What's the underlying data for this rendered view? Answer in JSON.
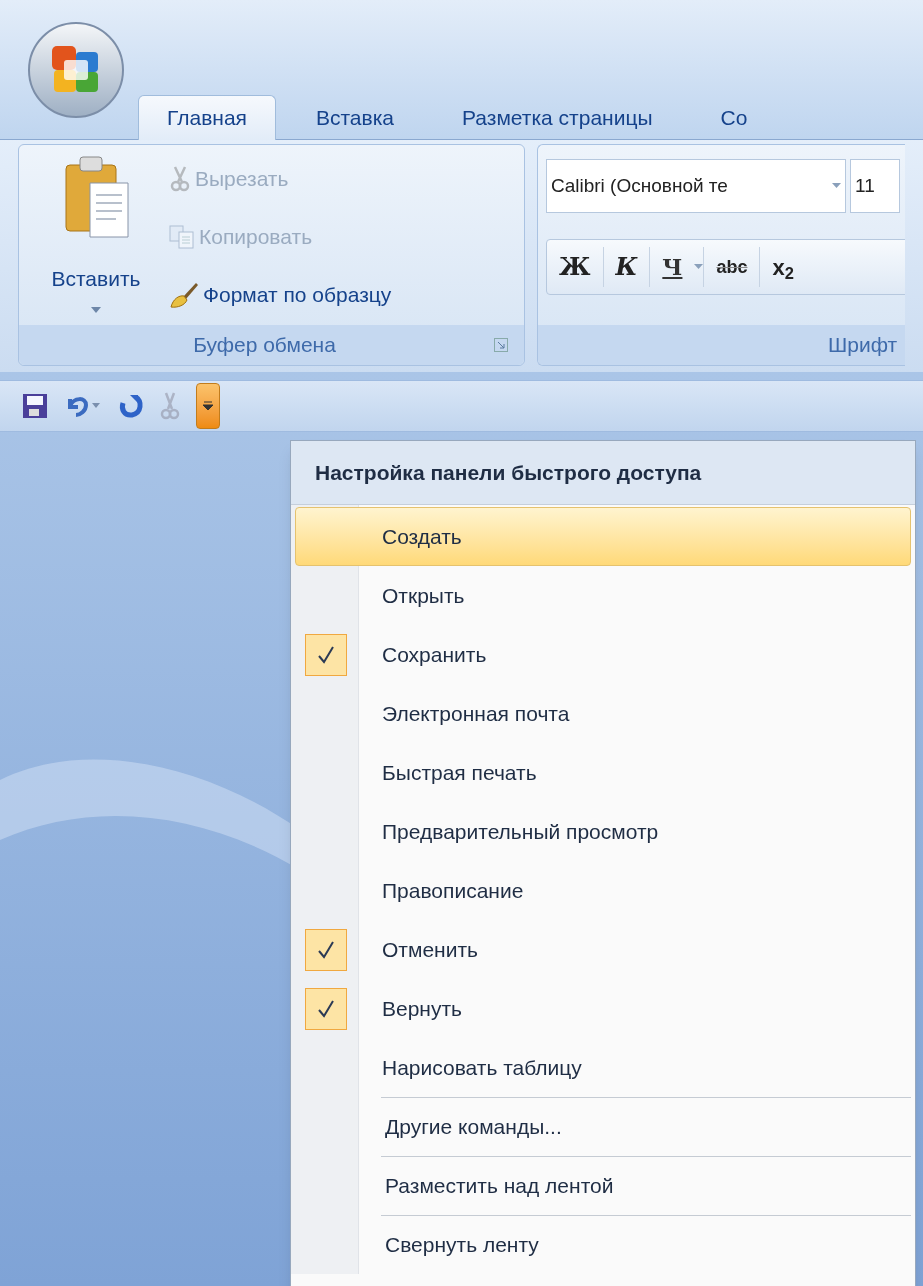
{
  "tabs": [
    {
      "label": "Главная",
      "selected": true
    },
    {
      "label": "Вставка",
      "selected": false
    },
    {
      "label": "Разметка страницы",
      "selected": false
    },
    {
      "label": "Со",
      "selected": false
    }
  ],
  "clipboard_group": {
    "title": "Буфер обмена",
    "paste": "Вставить",
    "commands": [
      {
        "kind": "cut",
        "label": "Вырезать",
        "disabled": true
      },
      {
        "kind": "copy",
        "label": "Копировать",
        "disabled": true
      },
      {
        "kind": "painter",
        "label": "Формат по образцу",
        "disabled": false
      }
    ]
  },
  "font_group": {
    "title": "Шрифт",
    "font_name": "Calibri (Основной те",
    "font_size": "11",
    "buttons": [
      {
        "kind": "bold",
        "label": "Ж"
      },
      {
        "kind": "italic",
        "label": "К"
      },
      {
        "kind": "underline",
        "label": "Ч"
      },
      {
        "kind": "strike",
        "label": "abc"
      },
      {
        "kind": "subscript",
        "label": "x$_{2}$"
      }
    ]
  },
  "quick_access": {
    "menu_open": true
  },
  "menu": {
    "title": "Настройка панели быстрого доступа",
    "items": [
      {
        "label": "Создать",
        "checked": false,
        "selected": true
      },
      {
        "label": "Открыть",
        "checked": false,
        "selected": false
      },
      {
        "label": "Сохранить",
        "checked": true,
        "selected": false
      },
      {
        "label": "Электронная почта",
        "checked": false,
        "selected": false
      },
      {
        "label": "Быстрая печать",
        "checked": false,
        "selected": false
      },
      {
        "label": "Предварительный просмотр",
        "checked": false,
        "selected": false
      },
      {
        "label": "Правописание",
        "checked": false,
        "selected": false
      },
      {
        "label": "Отменить",
        "checked": true,
        "selected": false
      },
      {
        "label": "Вернуть",
        "checked": true,
        "selected": false
      },
      {
        "label": "Нарисовать таблицу",
        "checked": false,
        "selected": false
      }
    ],
    "extra_items": [
      "Другие команды...",
      "Разместить над лентой",
      "Свернуть ленту"
    ]
  }
}
